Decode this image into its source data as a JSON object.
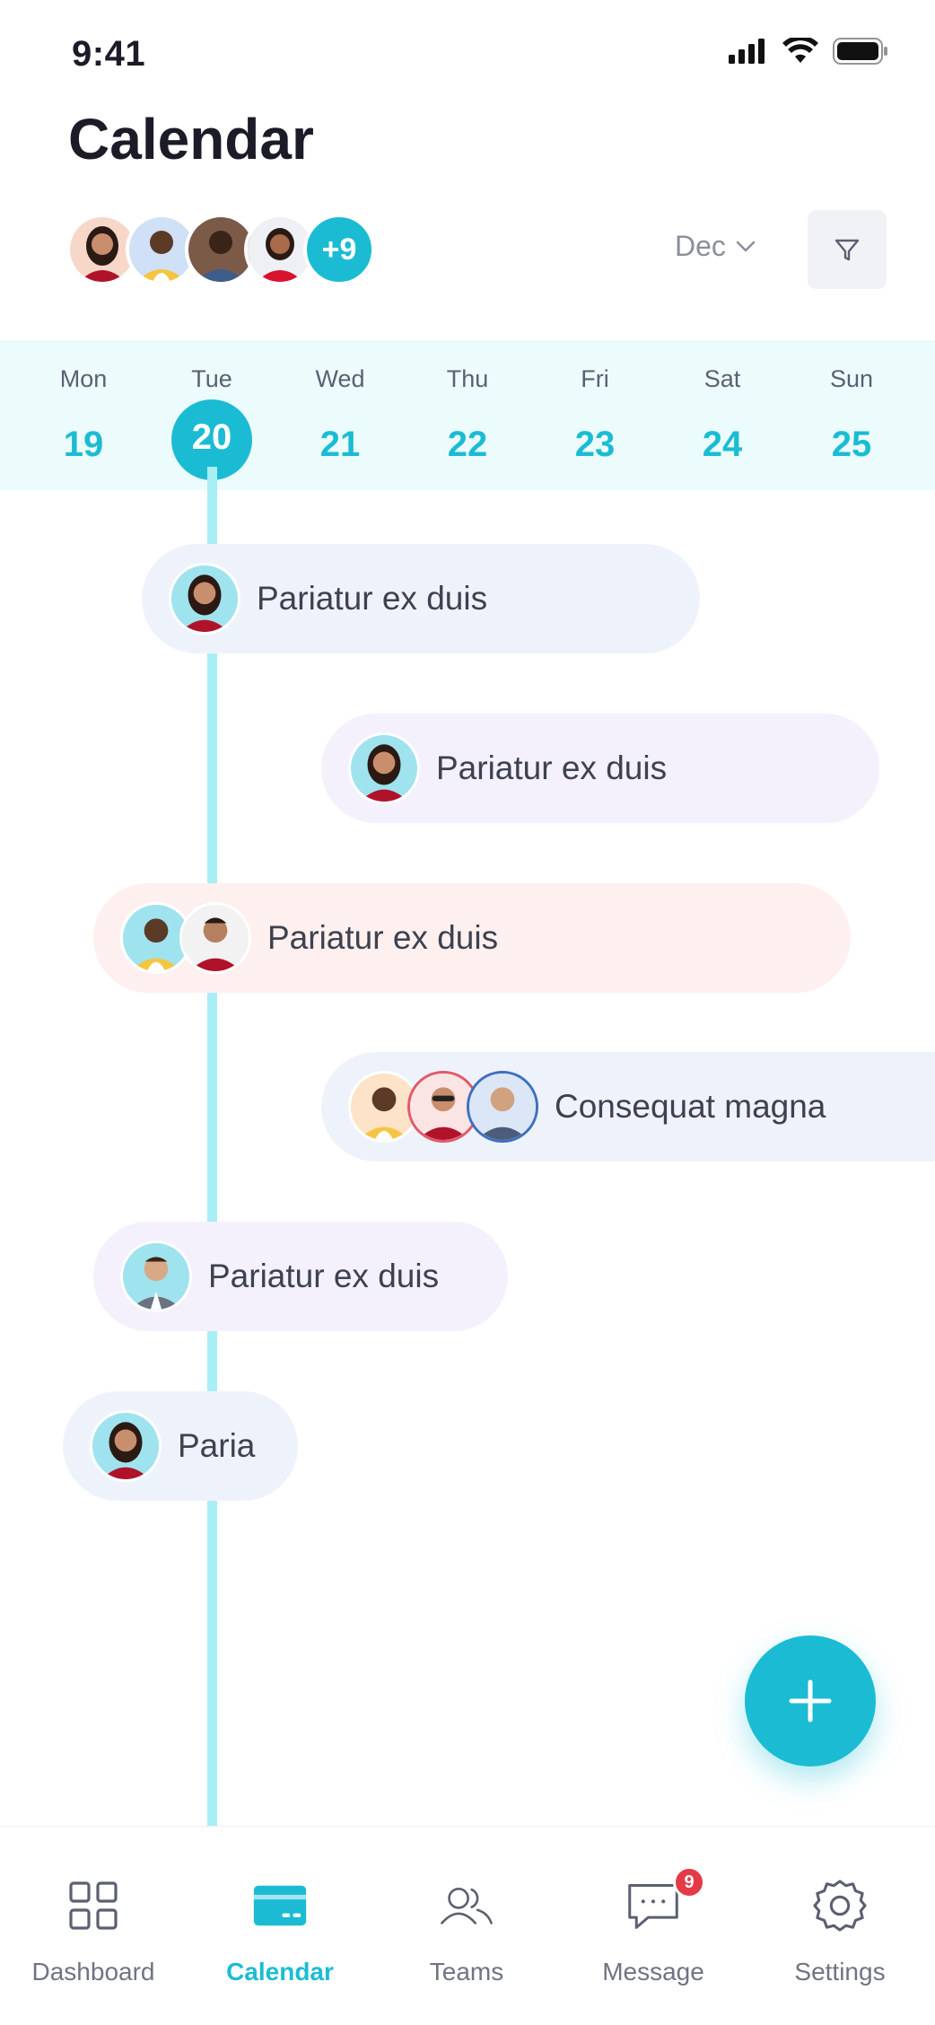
{
  "status_bar": {
    "time": "9:41"
  },
  "header": {
    "title": "Calendar",
    "more_members": "+9",
    "month": "Dec"
  },
  "week": {
    "days": [
      {
        "name": "Mon",
        "num": "19"
      },
      {
        "name": "Tue",
        "num": "20",
        "selected": true
      },
      {
        "name": "Wed",
        "num": "21"
      },
      {
        "name": "Thu",
        "num": "22"
      },
      {
        "name": "Fri",
        "num": "23"
      },
      {
        "name": "Sat",
        "num": "24"
      },
      {
        "name": "Sun",
        "num": "25"
      }
    ]
  },
  "events": [
    {
      "title": "Pariatur ex duis",
      "color": "#eef3fb"
    },
    {
      "title": "Pariatur ex duis",
      "color": "#f4f0fc"
    },
    {
      "title": "Pariatur ex duis",
      "color": "#fdf0ee"
    },
    {
      "title": "Consequat magna",
      "color": "#eef3fb"
    },
    {
      "title": "Pariatur ex duis",
      "color": "#f4f0fc"
    },
    {
      "title": "Paria",
      "color": "#eef3fb"
    }
  ],
  "bottom_nav": {
    "items": [
      {
        "label": "Dashboard"
      },
      {
        "label": "Calendar",
        "active": true
      },
      {
        "label": "Teams"
      },
      {
        "label": "Message",
        "badge": "9"
      },
      {
        "label": "Settings"
      }
    ]
  },
  "colors": {
    "accent": "#1bbcd3",
    "timeline": "#a8eef5",
    "badge": "#e63946"
  }
}
